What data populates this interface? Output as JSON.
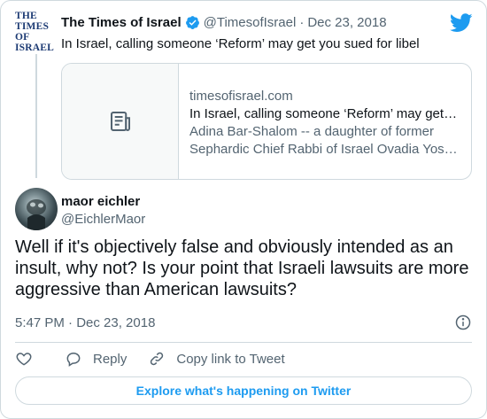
{
  "parent_tweet": {
    "avatar_lines": [
      "THE TIMES",
      "OF ISRAEL"
    ],
    "display_name": "The Times of Israel",
    "handle": "@TimesofIsrael",
    "separator": "·",
    "date": "Dec 23, 2018",
    "text": "In Israel, calling someone ‘Reform’ may get you sued for libel",
    "link_card": {
      "domain": "timesofisrael.com",
      "title": "In Israel, calling someone ‘Reform’ may get …",
      "description_line1": "Adina Bar-Shalom -- a daughter of former",
      "description_line2": "Sephardic Chief Rabbi of Israel Ovadia Yos…",
      "thumbnail_icon": "document-icon"
    }
  },
  "main_tweet": {
    "display_name": "maor eichler",
    "handle": "@EichlerMaor",
    "text": "Well if it's objectively false and obviously intended as an insult, why not? Is your point that Israeli lawsuits are more aggressive than American lawsuits?",
    "timestamp": "5:47 PM · Dec 23, 2018"
  },
  "actions": {
    "like_icon": "heart-icon",
    "reply_label": "Reply",
    "copy_link_label": "Copy link to Tweet"
  },
  "explore_label": "Explore what's happening on Twitter",
  "colors": {
    "accent": "#1d9bf0",
    "muted": "#536471",
    "border": "#cfd9de",
    "brand_navy": "#1c3a73"
  }
}
